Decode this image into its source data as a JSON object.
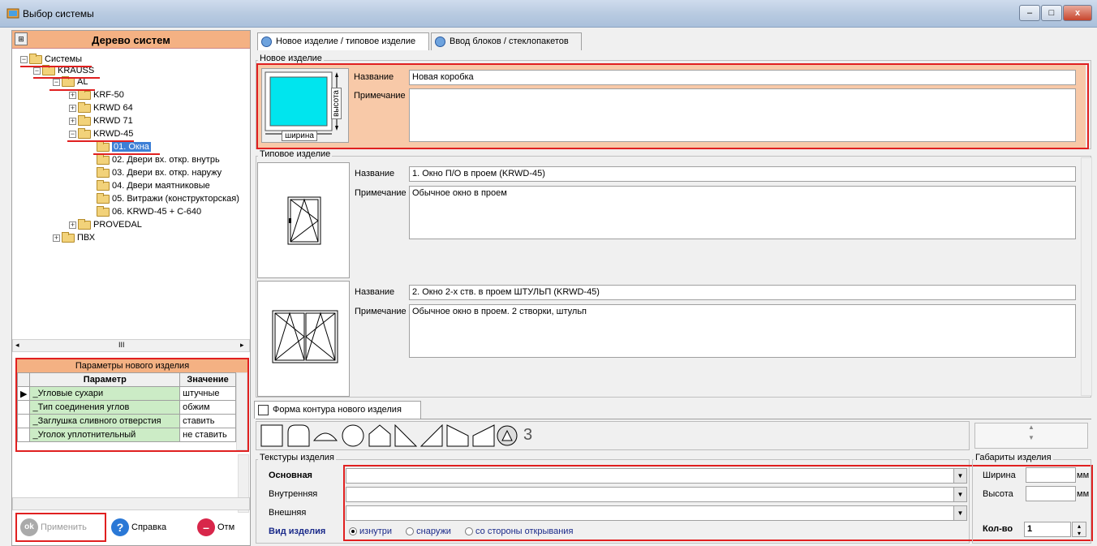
{
  "window": {
    "title": "Выбор системы",
    "min": "–",
    "max": "□",
    "close": "x"
  },
  "tree": {
    "header": "Дерево систем",
    "nodes": [
      {
        "label": "Системы",
        "pm": "−"
      },
      {
        "label": "KRAUSS",
        "pm": "−"
      },
      {
        "label": "AL",
        "pm": "−"
      },
      {
        "label": "KRF-50",
        "pm": "+"
      },
      {
        "label": "KRWD 64",
        "pm": "+"
      },
      {
        "label": "KRWD 71",
        "pm": "+"
      },
      {
        "label": "KRWD-45",
        "pm": "−"
      },
      {
        "label": "01. Окна",
        "pm": ""
      },
      {
        "label": "02. Двери вх. откр. внутрь",
        "pm": ""
      },
      {
        "label": "03. Двери вх. откр. наружу",
        "pm": ""
      },
      {
        "label": "04. Двери маятниковые",
        "pm": ""
      },
      {
        "label": "05. Витражи (конструкторская)",
        "pm": ""
      },
      {
        "label": "06. KRWD-45 + C-640",
        "pm": ""
      },
      {
        "label": "PROVEDAL",
        "pm": "+"
      },
      {
        "label": "ПВХ",
        "pm": "+"
      }
    ],
    "hscroll_thumb": "III"
  },
  "params": {
    "title": "Параметры нового изделия",
    "col_param": "Параметр",
    "col_value": "Значение",
    "rows": [
      {
        "name": "_Угловые сухари",
        "value": "штучные"
      },
      {
        "name": "_Тип соединения углов",
        "value": "обжим"
      },
      {
        "name": "_Заглушка сливного отверстия",
        "value": "ставить"
      },
      {
        "name": "_Уголок уплотнительный",
        "value": "не ставить"
      }
    ]
  },
  "buttons": {
    "apply": "Применить",
    "help": "Справка",
    "cancel": "Отм"
  },
  "tabs": [
    {
      "label": "Новое изделие / типовое изделие"
    },
    {
      "label": "Ввод блоков / стеклопакетов"
    }
  ],
  "new_item": {
    "group": "Новое изделие",
    "name_label": "Название",
    "name_value": "Новая коробка",
    "note_label": "Примечание",
    "note_value": "",
    "width_label": "ширина",
    "height_label": "высота"
  },
  "typical": {
    "group": "Типовое изделие",
    "items": [
      {
        "name_label": "Название",
        "name": "1. Окно П/О в проем (KRWD-45)",
        "note_label": "Примечание",
        "note": "Обычное окно в проем"
      },
      {
        "name_label": "Название",
        "name": "2. Окно 2-х ств. в проем ШТУЛЬП (KRWD-45)",
        "note_label": "Примечание",
        "note": "Обычное окно в проем. 2 створки, штульп"
      }
    ]
  },
  "contour": {
    "tab": "Форма контура нового изделия",
    "extra": "3"
  },
  "textures": {
    "group": "Текстуры изделия",
    "main": "Основная",
    "inner": "Внутренняя",
    "outer": "Внешняя",
    "view_label": "Вид изделия",
    "options": [
      "изнутри",
      "снаружи",
      "со стороны открывания"
    ]
  },
  "dims": {
    "group": "Габариты изделия",
    "width": "Ширина",
    "height": "Высота",
    "unit": "мм",
    "qty_label": "Кол-во",
    "qty": "1"
  },
  "colors": {
    "accent": "#f4b183",
    "highlight": "#e02020",
    "preview": "#00e5ee"
  }
}
